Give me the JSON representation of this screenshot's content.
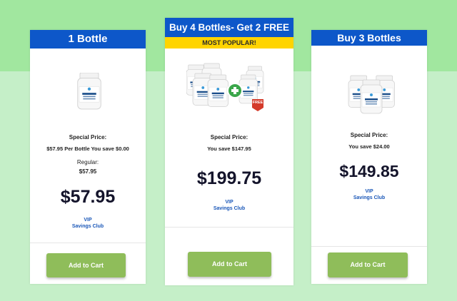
{
  "colors": {
    "header_blue": "#0d57c9",
    "popular_yellow": "#ffd400",
    "button_green": "#8fbd5a",
    "bg_light_green": "#c5efc8",
    "bg_top_green": "#a1e79f"
  },
  "cards": [
    {
      "title": "1 Bottle",
      "special_label": "Special Price:",
      "special_detail": "$57.95 Per Bottle You save $0.00",
      "regular_label": "Regular:",
      "regular_price": "$57.95",
      "price": "$57.95",
      "vip_line1": "VIP",
      "vip_line2": "Savings Club",
      "button": "Add to Cart",
      "image": "supplement-bottle-icon"
    },
    {
      "title": "Buy 4 Bottles- Get 2 FREE",
      "badge": "MOST POPULAR!",
      "special_label": "Special Price:",
      "special_detail": "You save $147.95",
      "price": "$199.75",
      "vip_line1": "VIP",
      "vip_line2": "Savings Club",
      "button": "Add to Cart",
      "image": "bottle-bundle-icon",
      "free_tag": "FREE"
    },
    {
      "title": "Buy 3 Bottles",
      "special_label": "Special Price:",
      "special_detail": "You save $24.00",
      "price": "$149.85",
      "vip_line1": "VIP",
      "vip_line2": "Savings Club",
      "button": "Add to Cart",
      "image": "three-bottles-icon"
    }
  ]
}
